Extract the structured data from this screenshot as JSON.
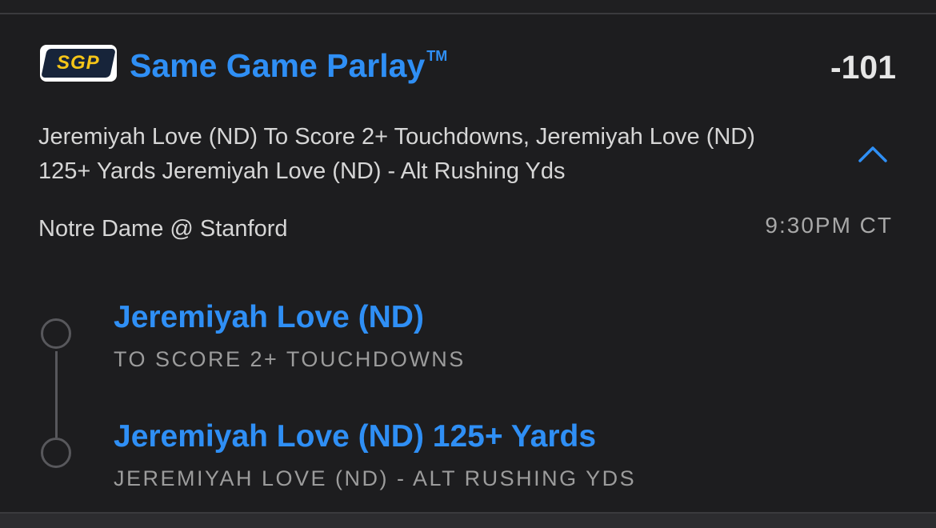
{
  "header": {
    "badge": "SGP",
    "title": "Same Game Parlay",
    "trademark": "TM",
    "odds": "-101"
  },
  "summary": {
    "text": "Jeremiyah Love (ND) To Score 2+ Touchdowns, Jeremiyah Love (ND) 125+ Yards Jeremiyah Love (ND) - Alt Rushing Yds",
    "toggle_icon": "chevron-up-icon"
  },
  "game": {
    "matchup": "Notre Dame @ Stanford",
    "time": "9:30PM CT"
  },
  "legs": [
    {
      "title": "Jeremiyah Love (ND)",
      "market": "TO SCORE 2+ TOUCHDOWNS"
    },
    {
      "title": "Jeremiyah Love (ND) 125+ Yards",
      "market": "JEREMIYAH LOVE (ND) - ALT RUSHING YDS"
    }
  ],
  "colors": {
    "accent": "#2f8ff5",
    "badge_yellow": "#f5c518",
    "background": "#1d1d1f"
  }
}
